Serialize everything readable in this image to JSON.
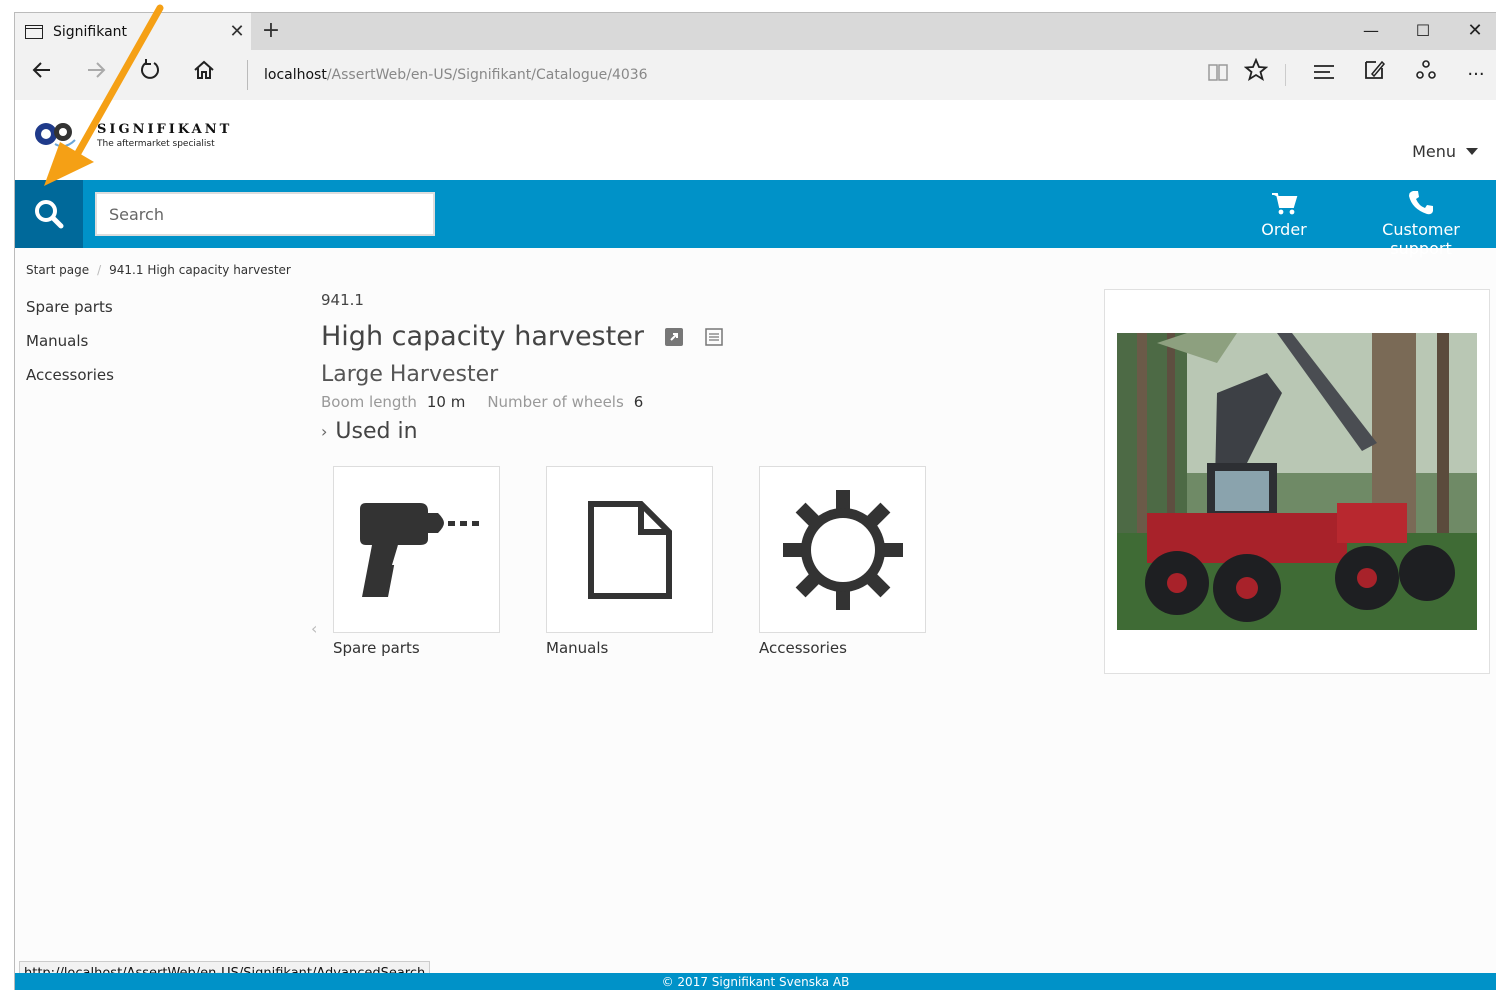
{
  "browser": {
    "tab_title": "Signifikant",
    "url_host": "localhost",
    "url_path": "/AssertWeb/en-US/Signifikant/Catalogue/4036",
    "status_url": "http://localhost/AssertWeb/en-US/Signifikant/AdvancedSearch"
  },
  "site": {
    "brand": "SIGNIFIKANT",
    "tagline": "The aftermarket specialist",
    "menu_label": "Menu",
    "search_placeholder": "Search",
    "order_label": "Order",
    "support_label": "Customer support",
    "accent_color": "#0092c8",
    "search_button_color": "#00699a"
  },
  "breadcrumb": {
    "home": "Start page",
    "current": "941.1 High capacity harvester"
  },
  "sidebar": {
    "items": [
      {
        "label": "Spare parts"
      },
      {
        "label": "Manuals"
      },
      {
        "label": "Accessories"
      }
    ]
  },
  "product": {
    "number": "941.1",
    "title": "High capacity harvester",
    "subtitle": "Large Harvester",
    "props": [
      {
        "label": "Boom length",
        "value": "10 m"
      },
      {
        "label": "Number of wheels",
        "value": "6"
      }
    ],
    "used_in_label": "Used in"
  },
  "cards": [
    {
      "label": "Spare parts",
      "icon": "drill-icon"
    },
    {
      "label": "Manuals",
      "icon": "document-icon"
    },
    {
      "label": "Accessories",
      "icon": "gear-icon"
    }
  ],
  "footer": {
    "copyright": "© 2017 Signifikant Svenska AB"
  }
}
